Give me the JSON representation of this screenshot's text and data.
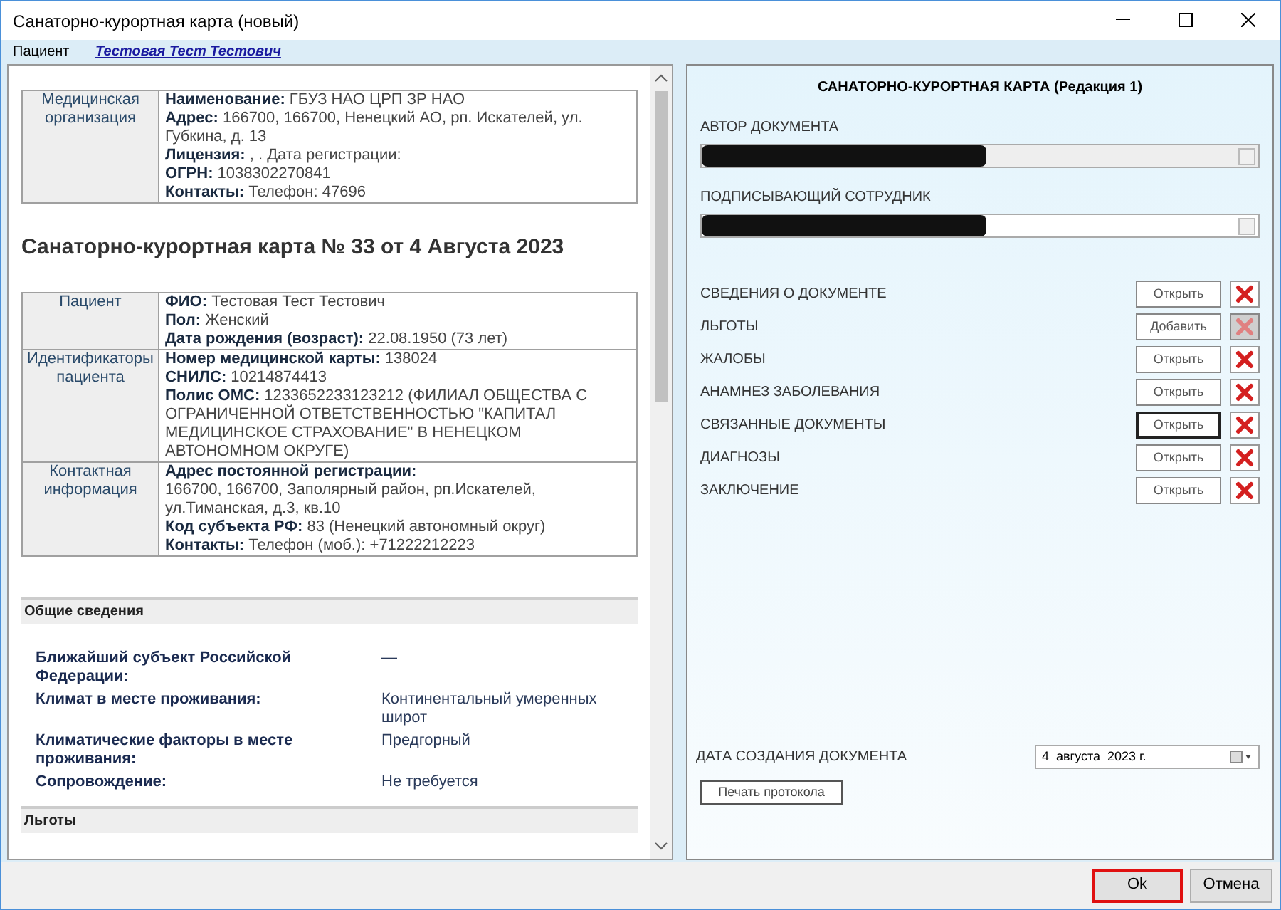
{
  "window": {
    "title": "Санаторно-курортная карта (новый)"
  },
  "patient_bar": {
    "label": "Пациент",
    "name": "Тестовая Тест Тестович"
  },
  "organization_table": [
    {
      "header": "Медицинская организация",
      "fields": [
        "**Наименование:** ГБУЗ НАО ЦРП ЗР НАО",
        "**Адрес:** 166700, 166700, Ненецкий АО, рп. Искателей, ул. Губкина, д. 13",
        "**Лицензия:** , . Дата регистрации:",
        "**ОГРН:** 1038302270841",
        "**Контакты:** Телефон: 47696"
      ]
    }
  ],
  "document_heading": "Санаторно-курортная карта № 33 от 4 Августа 2023",
  "patient_table": [
    {
      "header": "Пациент",
      "fields": [
        "**ФИО:** Тестовая Тест Тестович",
        "**Пол:** Женский",
        "**Дата рождения (возраст):** 22.08.1950 (73 лет)"
      ]
    },
    {
      "header": "Идентификаторы пациента",
      "fields": [
        "**Номер медицинской карты:** 138024",
        "**СНИЛС:** 10214874413",
        "**Полис ОМС:** 1233652233123212 (ФИЛИАЛ ОБЩЕСТВА С ОГРАНИЧЕННОЙ ОТВЕТСТВЕННОСТЬЮ \"КАПИТАЛ МЕДИЦИНСКОЕ СТРАХОВАНИЕ\" В НЕНЕЦКОМ АВТОНОМНОМ ОКРУГЕ)"
      ]
    },
    {
      "header": "Контактная информация",
      "fields": [
        "**Адрес постоянной регистрации:**",
        "166700, 166700, Заполярный район, рп.Искателей, ул.Тиманская, д.3, кв.10",
        "**Код субъекта РФ:** 83 (Ненецкий автономный округ)",
        "**Контакты:** Телефон (моб.): +71222212223"
      ]
    }
  ],
  "sections": [
    {
      "title": "Общие сведения",
      "rows": [
        {
          "label": "Ближайший субъект Российской Федерации:",
          "value": "—"
        },
        {
          "label": "Климат в месте проживания:",
          "value": "Континентальный умеренных широт"
        },
        {
          "label": "Климатические факторы в месте проживания:",
          "value": "Предгорный"
        },
        {
          "label": "Сопровождение:",
          "value": "Не требуется"
        }
      ]
    },
    {
      "title": "Льготы"
    }
  ],
  "form": {
    "title": "САНАТОРНО-КУРОРТНАЯ КАРТА (Редакция 1)",
    "author": {
      "label": "АВТОР ДОКУМЕНТА",
      "disabled": true
    },
    "signer": {
      "label": "ПОДПИСЫВАЮЩИЙ СОТРУДНИК",
      "disabled": false
    },
    "items": [
      {
        "label": "СВЕДЕНИЯ О ДОКУМЕНТЕ",
        "button": "Открыть",
        "focused": false,
        "delete_disabled": false
      },
      {
        "label": "ЛЬГОТЫ",
        "button": "Добавить",
        "focused": false,
        "delete_disabled": true
      },
      {
        "label": "ЖАЛОБЫ",
        "button": "Открыть",
        "focused": false,
        "delete_disabled": false
      },
      {
        "label": "АНАМНЕЗ ЗАБОЛЕВАНИЯ",
        "button": "Открыть",
        "focused": false,
        "delete_disabled": false
      },
      {
        "label": "СВЯЗАННЫЕ ДОКУМЕНТЫ",
        "button": "Открыть",
        "focused": true,
        "delete_disabled": false
      },
      {
        "label": "ДИАГНОЗЫ",
        "button": "Открыть",
        "focused": false,
        "delete_disabled": false
      },
      {
        "label": "ЗАКЛЮЧЕНИЕ",
        "button": "Открыть",
        "focused": false,
        "delete_disabled": false
      }
    ],
    "date_label": "ДАТА СОЗДАНИЯ ДОКУМЕНТА",
    "date_value": "4  августа  2023 г.",
    "print_button": "Печать протокола"
  },
  "footer": {
    "buttons": [
      {
        "label": "Ok",
        "highlighted": true
      },
      {
        "label": "Отмена",
        "highlighted": false
      }
    ]
  }
}
